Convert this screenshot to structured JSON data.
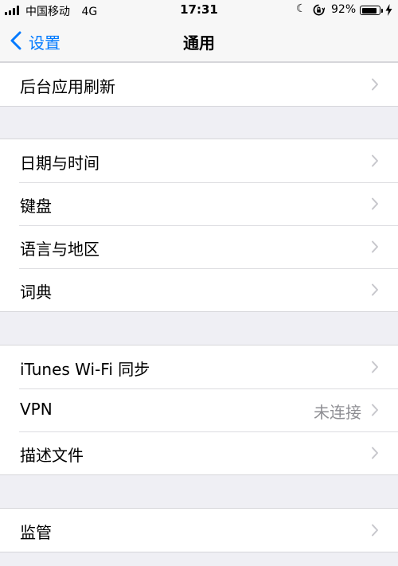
{
  "status_bar": {
    "carrier": "中国移动",
    "network": "4G",
    "time": "17:31",
    "battery_percent": "92%",
    "battery_level": 0.92,
    "icons": [
      "signal-icon",
      "moon-icon",
      "rotation-lock-icon",
      "battery-icon",
      "charging-icon"
    ]
  },
  "nav": {
    "back_label": "设置",
    "title": "通用",
    "accent_color": "#007aff"
  },
  "groups": [
    {
      "rows": [
        {
          "label": "后台应用刷新"
        }
      ]
    },
    {
      "rows": [
        {
          "label": "日期与时间"
        },
        {
          "label": "键盘"
        },
        {
          "label": "语言与地区"
        },
        {
          "label": "词典"
        }
      ]
    },
    {
      "rows": [
        {
          "label": "iTunes Wi-Fi 同步"
        },
        {
          "label": "VPN",
          "value": "未连接"
        },
        {
          "label": "描述文件"
        }
      ]
    },
    {
      "rows": [
        {
          "label": "监管"
        }
      ]
    }
  ]
}
